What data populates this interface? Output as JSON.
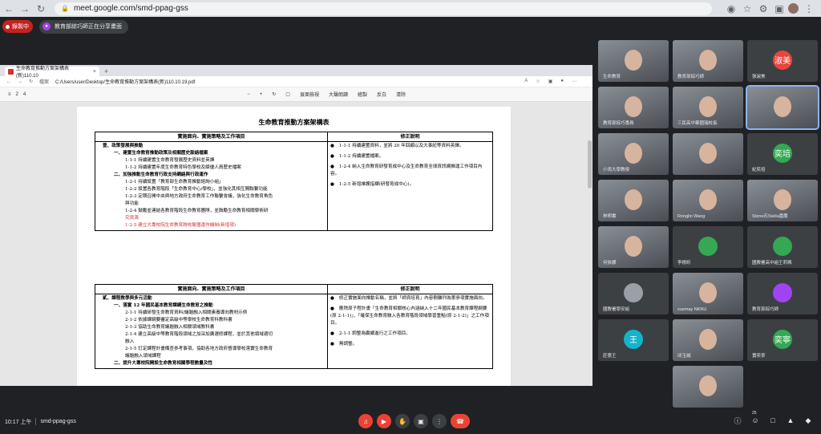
{
  "browser": {
    "url": "meet.google.com/smd-ppag-gss"
  },
  "meet": {
    "recording_label": "錄製中",
    "presenting_label": "教育部綜巧師正在分享畫面",
    "time": "10:17 上午",
    "meeting_code": "smd-ppag-gss",
    "participant_count": "25"
  },
  "shared": {
    "tab_title": "生命教育推動方案架構表(新)110.10",
    "address_prefix": "檔案",
    "address_path": "C:/Users/user/Desktop/生命教育推動方案架構表(新)110.10.19.pdf",
    "page_num": "2",
    "page_total": "4",
    "toolbar": {
      "fit": "頁面檢視",
      "read": "大聲朗讀",
      "draw": "繪製",
      "highlight": "反白",
      "erase": "清除"
    },
    "doc_title": "生命教育推動方案架構表",
    "table1": {
      "header_left": "實施面向、實施策略及工作項目",
      "header_right": "修正說明",
      "rows_left": [
        {
          "text": "壹、政策發展與推動",
          "cls": "bold ind1"
        },
        {
          "text": "一、建置生命教育推動政策及相關歷史脈絡檔案",
          "cls": "bold ind2"
        },
        {
          "text": "1-1-1 持續建置生命教育發展歷史資料並英譯",
          "cls": "ind3"
        },
        {
          "text": "1-1-2 持續建置年度生命教育特色學校及績優人員歷史檔案",
          "cls": "ind3"
        },
        {
          "text": "二、加強推動生命教育行政支持網絡與行政運作",
          "cls": "bold ind2"
        },
        {
          "text": "1-2-1 持續設置「教育部生命教育推動諮詢小組」",
          "cls": "ind3"
        },
        {
          "text": "1-2-2 設置各教育階段「生命教育中心/學校」，並強化其相互間聯繫功能",
          "cls": "ind3"
        },
        {
          "text": "1-2-3 定期召開中央與地方政府生命教育工作聯繫會議，強化生命教育角色",
          "cls": "ind3"
        },
        {
          "text": "與功能",
          "cls": "ind3"
        },
        {
          "text": "1-2-4 鼓勵並連結各教育階段生命教育團隊，並鼓勵生命教育相關學術研",
          "cls": "ind3"
        },
        {
          "text": "究資源",
          "cls": "ind3 red"
        },
        {
          "text": "1-2-5 建立大專校院生命教育跨校聯盟運作機制(新增項)",
          "cls": "ind3 red"
        }
      ],
      "rows_right": [
        "1-1-1 持續建置資料，並將 20 年回顧以及大事紀等資料英譯。",
        "1-1-2 持續建置檔案。",
        "1-2-4 納入生命教育研發育成中心及生命教育全球資訊網推運工作項目內容。",
        "1-2-5 新增維護指標(研發育成中心)。"
      ]
    },
    "table2": {
      "header_left": "實施面向、實施策略及工作項目",
      "header_right": "修正說明",
      "rows_left": [
        {
          "text": "貳、課程教學與多元活動",
          "cls": "bold ind1"
        },
        {
          "text": "一、落實 12 年國民基本教育課綱生命教育之推動",
          "cls": "bold ind2"
        },
        {
          "text": "2-1-1 持續研發生命教育資料/議題融入相關素養導向教材示例",
          "cls": "ind3"
        },
        {
          "text": "2-1-2 依據課綱要審定高級中等學校生命教育科教科書",
          "cls": "ind3"
        },
        {
          "text": "2-1-3 協助生命教育議題融入相關領域教科書",
          "cls": "ind3"
        },
        {
          "text": "2-1-4 建立高級中等教育階段領域之加深加廣選修課程，並於其他領域適切",
          "cls": "ind3"
        },
        {
          "text": "融入",
          "cls": "ind3"
        },
        {
          "text": "2-1-5 訂定課程計畫備查參考事項，協助各地方政府督導學校落實生命教育",
          "cls": "ind3"
        },
        {
          "text": "議題融入領域課程",
          "cls": "ind3"
        },
        {
          "text": "二、提升大專校院開設生命教育相關學程數量及性",
          "cls": "bold ind2"
        }
      ],
      "rows_right": [
        "修正實施面向推動名稱，並將「師資培育」內容刪離列為第參項實施面向。",
        "刪除原子程計畫「生命教育相關核心內涵納入十二年國民基本教育課程綱要(原 2-1-1)」、「確保生命教育融入各教育階段領域學習重點(原 2-1-2)」之工作項目。",
        "2-1-1 調整為賡續進行之工作項目。",
        "無調整。"
      ]
    }
  },
  "participants": [
    {
      "name": "生命教育",
      "avatar": "",
      "color": "#5f6368",
      "photo": true
    },
    {
      "name": "教育部綜巧師",
      "avatar": "",
      "color": "#5f6368",
      "photo": true
    },
    {
      "name": "張淑美",
      "avatar": "淑美",
      "color": "#e8453c",
      "photo": false
    },
    {
      "name": "教育部綜巧專員",
      "avatar": "",
      "color": "#5f6368",
      "photo": true
    },
    {
      "name": "三民高中蔡國瑞校長",
      "avatar": "",
      "color": "#5f6368",
      "photo": true
    },
    {
      "name": "",
      "avatar": "",
      "color": "#5f6368",
      "photo": true
    },
    {
      "name": "小雨大學教授",
      "avatar": "",
      "color": "#5f6368",
      "photo": true
    },
    {
      "name": "",
      "avatar": "",
      "color": "#5f6368",
      "photo": true
    },
    {
      "name": "紀奕培",
      "avatar": "奕培",
      "color": "#34a853",
      "photo": false
    },
    {
      "name": "林明書",
      "avatar": "",
      "color": "#5f6368",
      "photo": true
    },
    {
      "name": "Ronglin Wang",
      "avatar": "",
      "color": "#5f6368",
      "photo": true
    },
    {
      "name": "Stone石Stella嘉蘭",
      "avatar": "",
      "color": "#5f6368",
      "photo": true
    },
    {
      "name": "何依娜",
      "avatar": "",
      "color": "#5f6368",
      "photo": true
    },
    {
      "name": "李根昕",
      "avatar": "",
      "color": "#34a853",
      "photo": false
    },
    {
      "name": "國教署高中組王莉珮",
      "avatar": "",
      "color": "#34a853",
      "photo": false
    },
    {
      "name": "國教署學安組",
      "avatar": "",
      "color": "#9aa0a6",
      "photo": false
    },
    {
      "name": "suemay NKNU",
      "avatar": "",
      "color": "#5f6368",
      "photo": true
    },
    {
      "name": "教育部綜巧師",
      "avatar": "",
      "color": "#a142f4",
      "photo": false
    },
    {
      "name": "莊惠王",
      "avatar": "王",
      "color": "#12b5cb",
      "photo": false
    },
    {
      "name": "邱玉誠",
      "avatar": "",
      "color": "#5f6368",
      "photo": true
    },
    {
      "name": "寶奕寧",
      "avatar": "奕寧",
      "color": "#34a853",
      "photo": false
    },
    {
      "name": "",
      "avatar": "",
      "color": "#5f6368",
      "photo": true
    }
  ]
}
